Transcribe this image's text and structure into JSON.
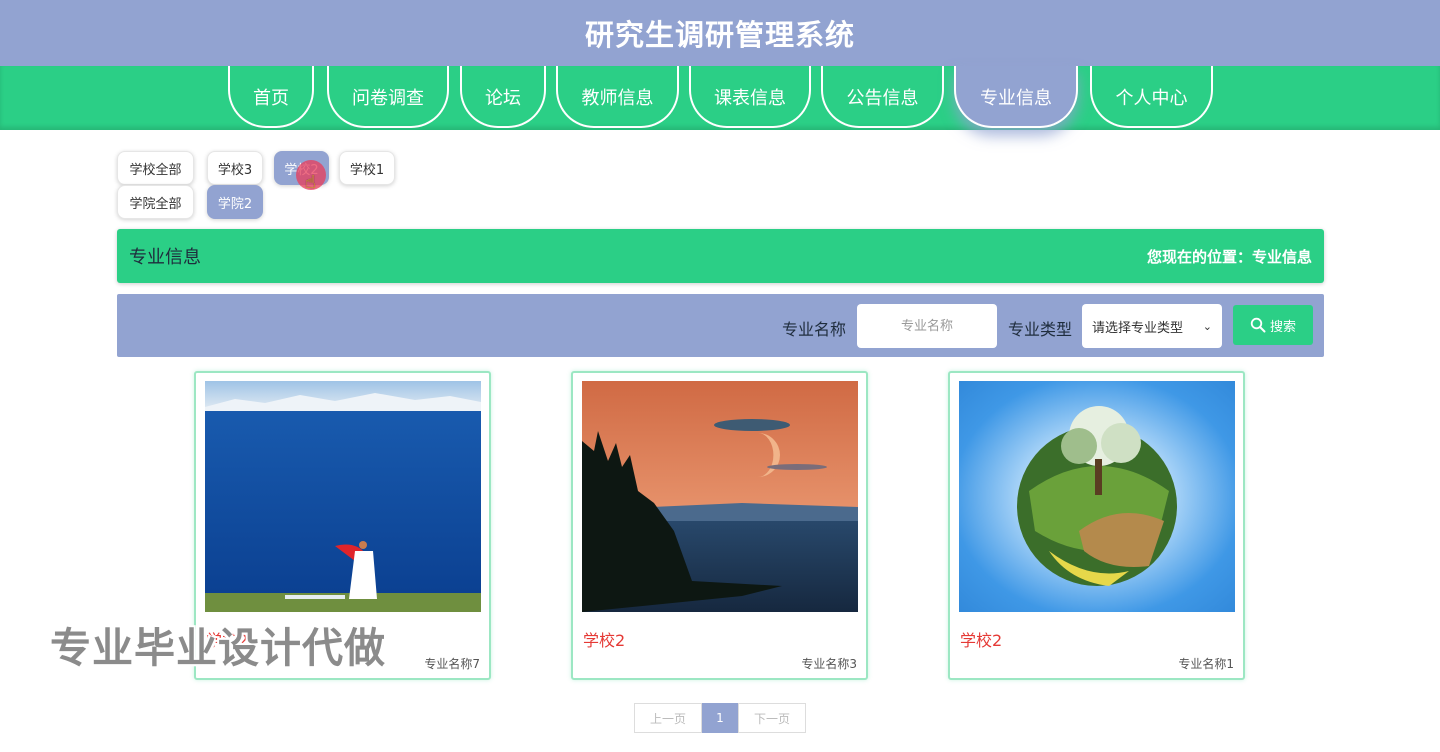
{
  "header": {
    "title": "研究生调研管理系统"
  },
  "nav": {
    "items": [
      {
        "label": "首页"
      },
      {
        "label": "问卷调查"
      },
      {
        "label": "论坛"
      },
      {
        "label": "教师信息"
      },
      {
        "label": "课表信息"
      },
      {
        "label": "公告信息"
      },
      {
        "label": "专业信息",
        "active": true
      },
      {
        "label": "个人中心"
      }
    ]
  },
  "filters": {
    "schools": [
      "学校全部",
      "学校3",
      "学校2",
      "学校1"
    ],
    "selected_school": "学校2",
    "colleges": [
      "学院全部",
      "学院2"
    ],
    "selected_college": "学院2"
  },
  "section": {
    "title": "专业信息",
    "location": "您现在的位置：专业信息"
  },
  "search": {
    "name_label": "专业名称",
    "name_placeholder": "专业名称",
    "type_label": "专业类型",
    "type_selected": "请选择专业类型",
    "button_label": "搜索"
  },
  "cards": [
    {
      "school": "学校2",
      "major": "专业名称7"
    },
    {
      "school": "学校2",
      "major": "专业名称3"
    },
    {
      "school": "学校2",
      "major": "专业名称1"
    }
  ],
  "pagination": {
    "prev": "上一页",
    "current": "1",
    "next": "下一页"
  },
  "overlay": {
    "watermark": "专业毕业设计代做"
  },
  "colors": {
    "primary": "#92a3d1",
    "accent": "#2bcf86",
    "card_title": "#e53935"
  }
}
